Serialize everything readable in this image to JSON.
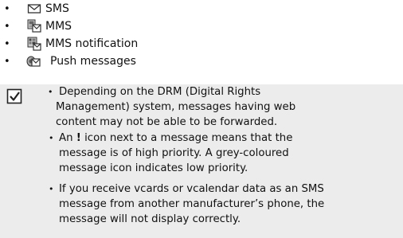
{
  "message_types": [
    {
      "icon": "envelope-icon",
      "label": "SMS"
    },
    {
      "icon": "mms-icon",
      "label": "MMS"
    },
    {
      "icon": "mms-notification-icon",
      "label": "MMS notification"
    },
    {
      "icon": "push-message-icon",
      "label": "Push messages"
    }
  ],
  "bullet_char": "•",
  "note": {
    "icon": "checkbox-icon",
    "items": [
      {
        "lines": [
          "Depending on the DRM (Digital Rights",
          "Management) system, messages having web",
          "content may not be able to be forwarded."
        ]
      },
      {
        "lines_first_prefix": "An ",
        "lines_first_mark": "!",
        "lines_first_suffix": " icon next to a message means that the",
        "lines": [
          "message is of high priority. A grey-coloured",
          "message icon indicates low priority."
        ]
      },
      {
        "lines": [
          "If you receive vcards or vcalendar data as an SMS",
          "message from another manufacturer’s phone, the",
          "message will not display correctly."
        ]
      }
    ]
  }
}
